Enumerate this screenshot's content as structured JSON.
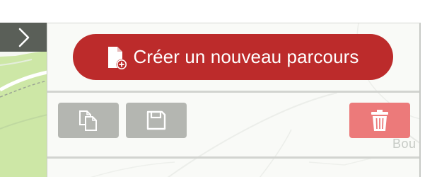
{
  "toolbar": {
    "create_button_label": "Créer un nouveau parcours",
    "create_icon": "file-plus-icon",
    "copy_icon": "copy-icon",
    "save_icon": "floppy-disk-icon",
    "delete_icon": "trash-icon"
  },
  "sidebar_toggle": {
    "icon": "chevron-right-icon"
  },
  "map": {
    "place_label": "Bou"
  },
  "colors": {
    "accent": "#bc2b2b",
    "delete": "#ec7a7a",
    "tool_button": "#b4b6b1",
    "toggle_bg": "#5a5f58",
    "map_green": "#cde7a6"
  }
}
